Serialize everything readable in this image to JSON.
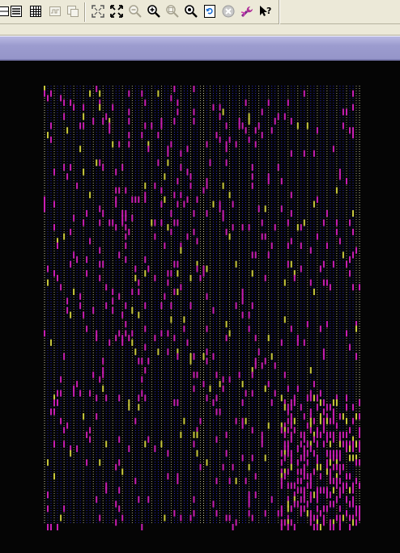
{
  "toolbar": {
    "buttons": [
      {
        "name": "layout-view-button",
        "icon": "page-split-icon"
      },
      {
        "name": "list-view-button",
        "icon": "list-icon"
      },
      {
        "name": "table-view-button",
        "icon": "grid-table-icon"
      },
      {
        "name": "wave-view-button",
        "icon": "waveform-icon"
      },
      {
        "name": "schematic-view-button",
        "icon": "schematic-icon"
      },
      {
        "name": "zoom-fit-button",
        "icon": "zoom-fit-icon"
      },
      {
        "name": "zoom-full-button",
        "icon": "zoom-full-icon"
      },
      {
        "name": "zoom-out-button",
        "icon": "magnifier-minus-icon"
      },
      {
        "name": "zoom-in-button",
        "icon": "magnifier-plus-icon"
      },
      {
        "name": "zoom-area-button",
        "icon": "magnifier-area-icon"
      },
      {
        "name": "zoom-select-button",
        "icon": "magnifier-select-icon"
      },
      {
        "name": "refresh-button",
        "icon": "refresh-icon"
      },
      {
        "name": "stop-button",
        "icon": "stop-circle-icon"
      },
      {
        "name": "tools-button",
        "icon": "wrench-icon"
      },
      {
        "name": "context-help-button",
        "icon": "help-arrow-icon"
      }
    ]
  },
  "window": {
    "title": ""
  },
  "layout": {
    "colors": {
      "background": "#050505",
      "grid_primary": "#2a2ad8",
      "grid_secondary": "#c8c8a0",
      "highlight": "#c81eb4",
      "accent": "#c8c83c"
    },
    "grid_columns": 98,
    "grid_rows": 96
  }
}
